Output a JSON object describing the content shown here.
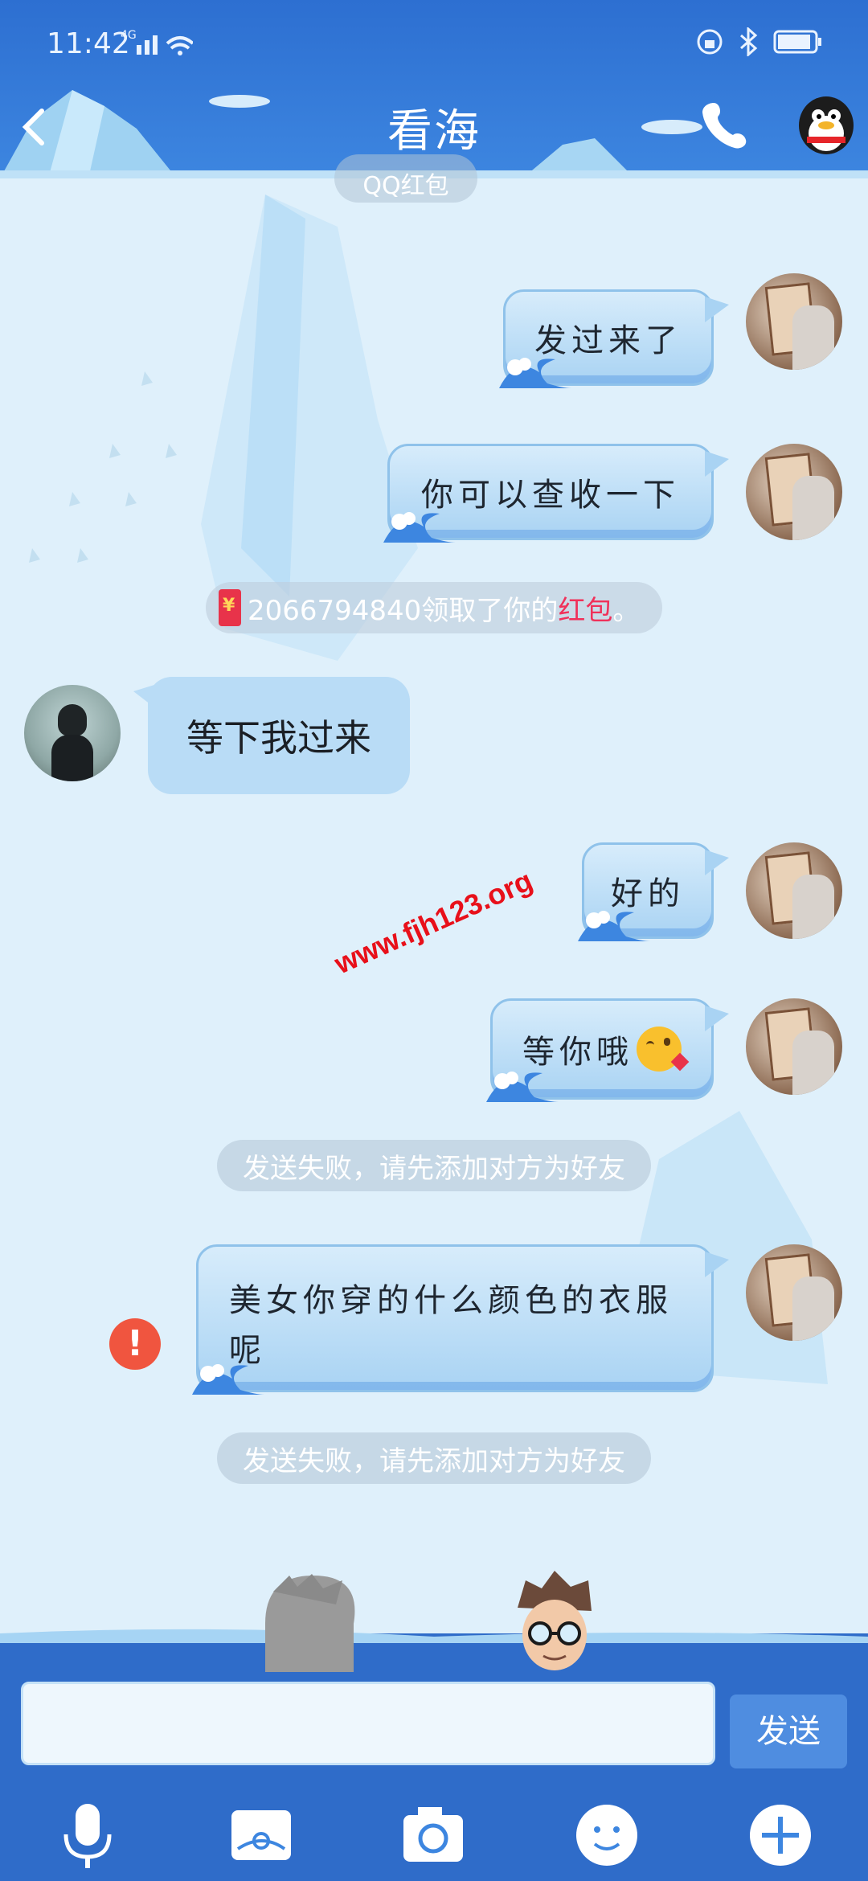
{
  "status_bar": {
    "time": "11:42",
    "network": "4G"
  },
  "header": {
    "title": "看海"
  },
  "messages": {
    "top_pill": "QQ红包",
    "me_1": "发过来了",
    "me_2": "你可以查收一下",
    "redpacket_notice": {
      "prefix": "2066794840领取了你的",
      "link": "红包",
      "suffix": "。"
    },
    "friend_1": "等下我过来",
    "me_3": "好的",
    "me_4": "等你哦",
    "fail_notice_1": "发送失败，请先添加对方为好友",
    "me_5_line1": "美女你穿的什么颜色的衣服",
    "me_5_line2": "呢",
    "fail_notice_2": "发送失败，请先添加对方为好友",
    "watermark": "www.fjh123.org"
  },
  "input": {
    "placeholder": "",
    "send_label": "发送"
  },
  "colors": {
    "header": "#2d6fd1",
    "chat_bg": "#dff0fb",
    "send_button": "#4f8de0",
    "error": "#f0553f",
    "redpacket_link": "#f0315a"
  },
  "icons": [
    "back-icon",
    "phone-icon",
    "penguin-avatar-icon",
    "microphone-icon",
    "picture-icon",
    "camera-icon",
    "emoji-icon",
    "plus-icon"
  ]
}
